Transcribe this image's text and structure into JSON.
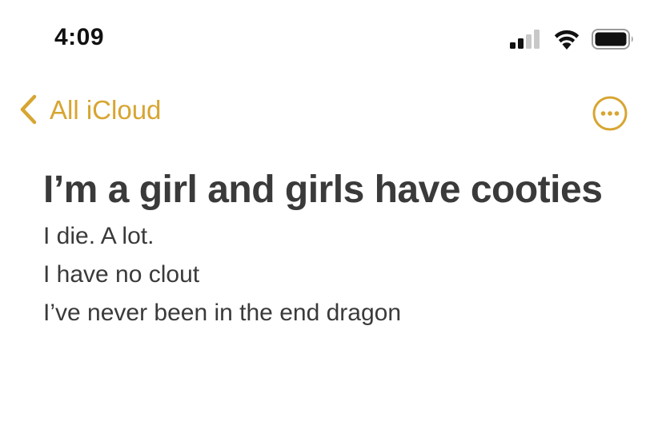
{
  "status_bar": {
    "time": "4:09",
    "icons": [
      "cellular-signal-icon",
      "wifi-icon",
      "battery-icon"
    ]
  },
  "nav": {
    "back_label": "All iCloud",
    "more_icon": "ellipsis-circle-icon",
    "accent_color": "#d7a531"
  },
  "note": {
    "title": "I’m a girl and girls have cooties",
    "lines": [
      "I die. A lot.",
      "I have no clout",
      "I’ve never been in the end dragon"
    ]
  }
}
